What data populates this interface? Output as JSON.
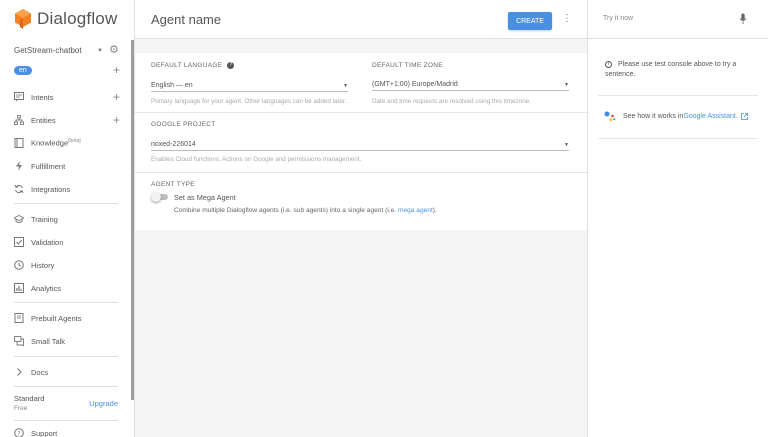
{
  "sidebar": {
    "brand": "Dialogflow",
    "agent_name": "GetStream-chatbot",
    "language_chip": "en",
    "items": [
      {
        "label": "Intents",
        "icon": "chat-icon"
      },
      {
        "label": "Entities",
        "icon": "hierarchy-icon"
      },
      {
        "label": "Knowledge",
        "badge": "[beta]",
        "icon": "book-icon"
      },
      {
        "label": "Fulfillment",
        "icon": "bolt-icon"
      },
      {
        "label": "Integrations",
        "icon": "sync-icon"
      },
      {
        "label": "Training",
        "icon": "graduation-cap-icon"
      },
      {
        "label": "Validation",
        "icon": "checkbox-icon"
      },
      {
        "label": "History",
        "icon": "clock-icon"
      },
      {
        "label": "Analytics",
        "icon": "bar-chart-icon"
      },
      {
        "label": "Prebuilt Agents",
        "icon": "document-icon"
      },
      {
        "label": "Small Talk",
        "icon": "chat-bubbles-icon"
      },
      {
        "label": "Docs",
        "icon": "chevron-right-icon"
      },
      {
        "label": "Support",
        "icon": "help-circle-icon"
      }
    ],
    "plan_name": "Standard",
    "plan_tier": "Free",
    "upgrade_label": "Upgrade"
  },
  "header": {
    "title": "Agent name",
    "create_label": "CREATE"
  },
  "settings": {
    "default_language_label": "DEFAULT LANGUAGE",
    "default_language_value": "English — en",
    "default_language_hint": "Primary language for your agent. Other languages can be added later.",
    "timezone_label": "DEFAULT TIME ZONE",
    "timezone_value": "(GMT+1:00) Europe/Madrid",
    "timezone_hint": "Date and time requests are resolved using this timezone.",
    "project_label": "GOOGLE PROJECT",
    "project_value": "noxed-226014",
    "project_hint": "Enables Cloud functions, Actions on Google and permissions management.",
    "agent_type_label": "AGENT TYPE",
    "mega_toggle_label": "Set as Mega Agent",
    "mega_desc_prefix": "Combine multiple Dialogflow agents (i.e. sub agents) into a single agent (i.e. ",
    "mega_desc_link": "mega agent",
    "mega_desc_suffix": ")."
  },
  "console": {
    "placeholder": "Try it now",
    "info_text": "Please use test console above to try a sentence.",
    "ga_prefix": "See how it works in ",
    "ga_link": "Google Assistant."
  },
  "colors": {
    "accent": "#4a90e2",
    "logo_orange": "#f4801f"
  }
}
